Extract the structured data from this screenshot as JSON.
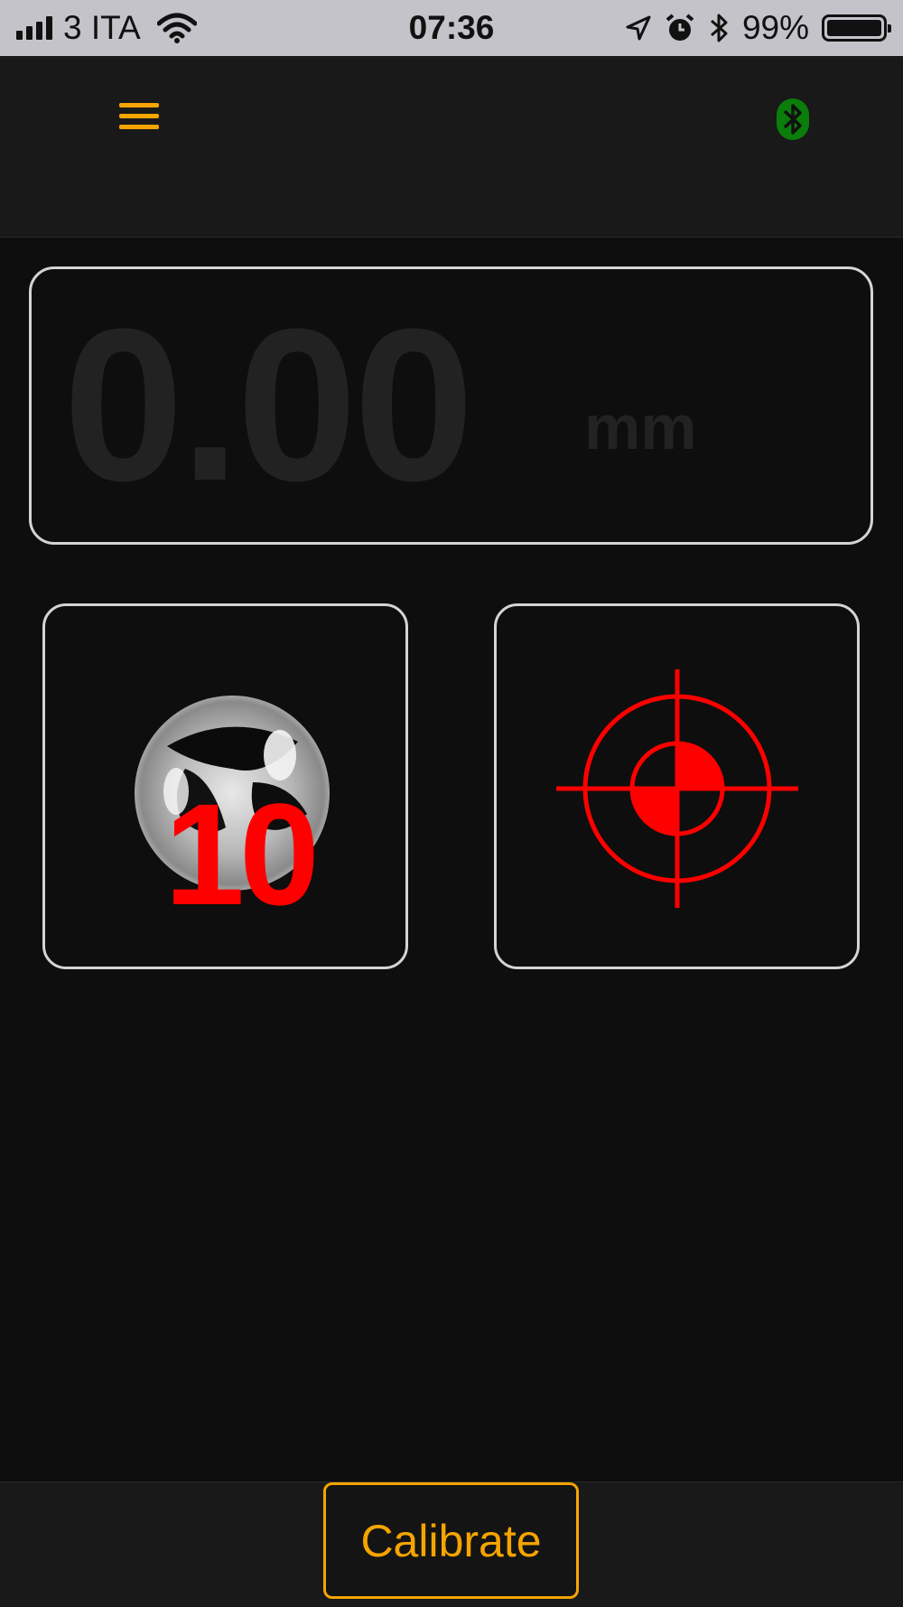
{
  "status_bar": {
    "carrier": "3 ITA",
    "time": "07:36",
    "battery_percent": "99%",
    "battery_level": 0.99,
    "icons": [
      "signal-bars-icon",
      "wifi-icon",
      "location-arrow-icon",
      "alarm-icon",
      "bluetooth-icon",
      "battery-icon"
    ]
  },
  "navbar": {
    "menu_icon": "hamburger-menu-icon",
    "bluetooth_icon": "bluetooth-connected-icon",
    "accent_color": "#f5a400",
    "bluetooth_color": "#0a7d0a"
  },
  "readout": {
    "value": "0.00",
    "unit": "mm"
  },
  "tiles": {
    "probe": {
      "icon": "steel-ball-icon",
      "number": "10"
    },
    "target": {
      "icon": "crosshair-target-icon",
      "color": "#ff0000"
    }
  },
  "footer": {
    "calibrate_label": "Calibrate"
  }
}
